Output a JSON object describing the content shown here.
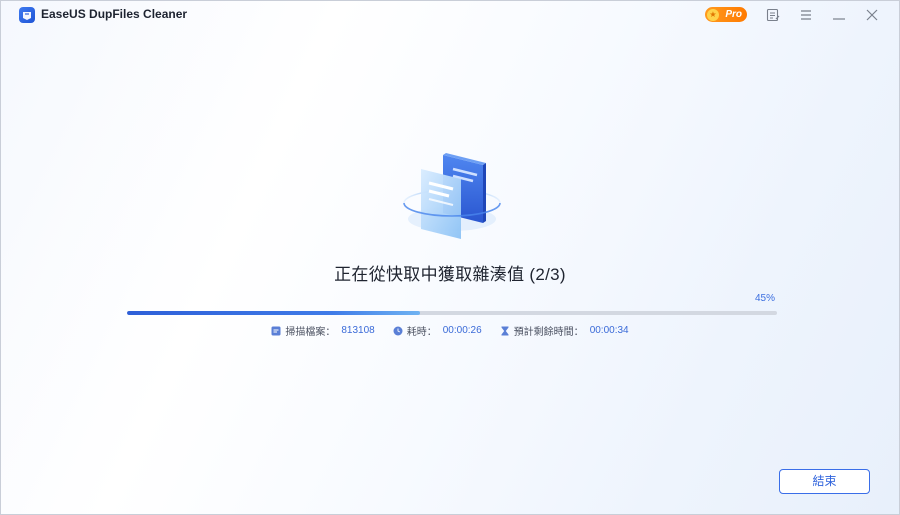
{
  "app": {
    "title": "EaseUS DupFiles Cleaner",
    "pro_label": "Pro"
  },
  "titlebar_icons": [
    "feedback-icon",
    "menu-icon",
    "minimize-icon",
    "close-icon"
  ],
  "scan": {
    "status_title": "正在從快取中獲取雜湊值 (2/3)",
    "progress_percent": 45,
    "progress_label": "45%"
  },
  "stats": {
    "files_label": "掃描檔案：",
    "files_value": "813108",
    "elapsed_label": "耗時：",
    "elapsed_value": "00:00:26",
    "remaining_label": "預計剩餘時間：",
    "remaining_value": "00:00:34"
  },
  "actions": {
    "finish_label": "結束"
  },
  "colors": {
    "accent": "#2f63dc",
    "pro": "#ff8a10",
    "track": "#d3d8e1"
  }
}
